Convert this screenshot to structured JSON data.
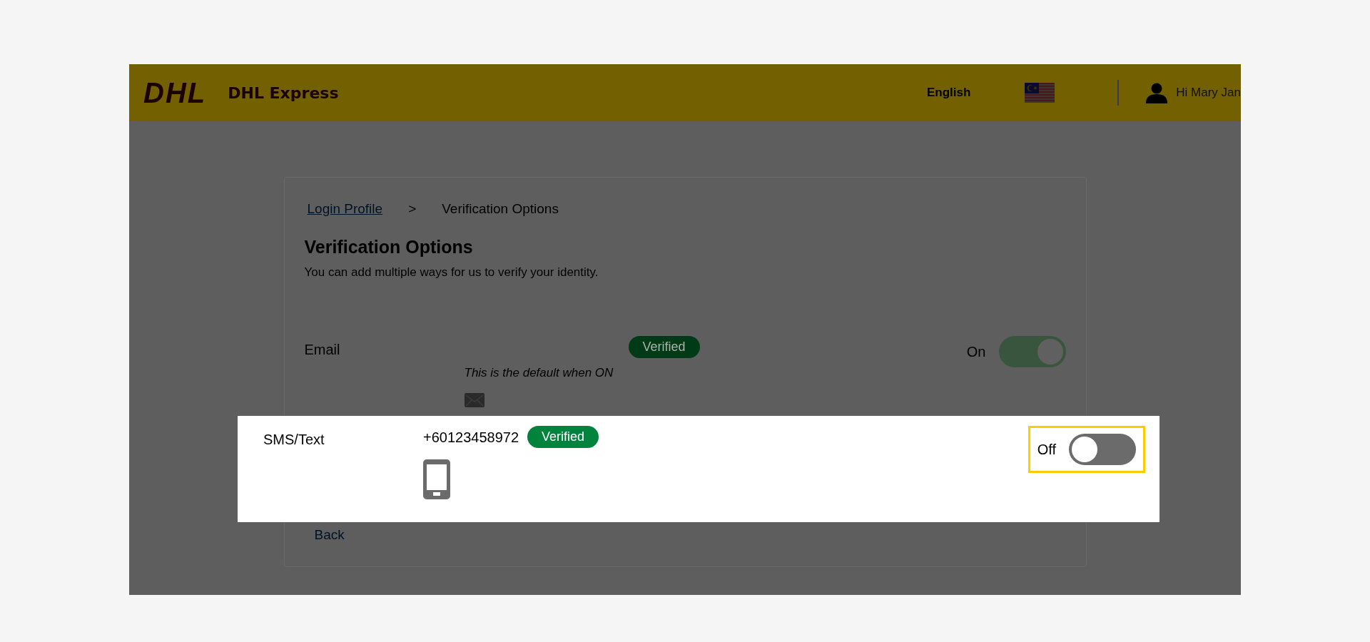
{
  "header": {
    "logo": "DHL",
    "brand": "DHL Express",
    "language": "English",
    "greeting": "Hi Mary Jan"
  },
  "breadcrumb": {
    "link": "Login Profile",
    "separator": ">",
    "current": "Verification Options"
  },
  "title": "Verification Options",
  "subtitle": "You can add multiple ways for us to verify your identity.",
  "methods": [
    {
      "kind": "email",
      "label": "Email",
      "badge": "Verified",
      "note": "This is the default when ON",
      "on": true,
      "toggle_label": "On",
      "highlighted": false
    },
    {
      "kind": "sms",
      "label": "SMS/Text",
      "value": "+60123458972",
      "badge": "Verified",
      "on": false,
      "toggle_label": "Off",
      "highlighted": true
    }
  ],
  "back": "Back"
}
